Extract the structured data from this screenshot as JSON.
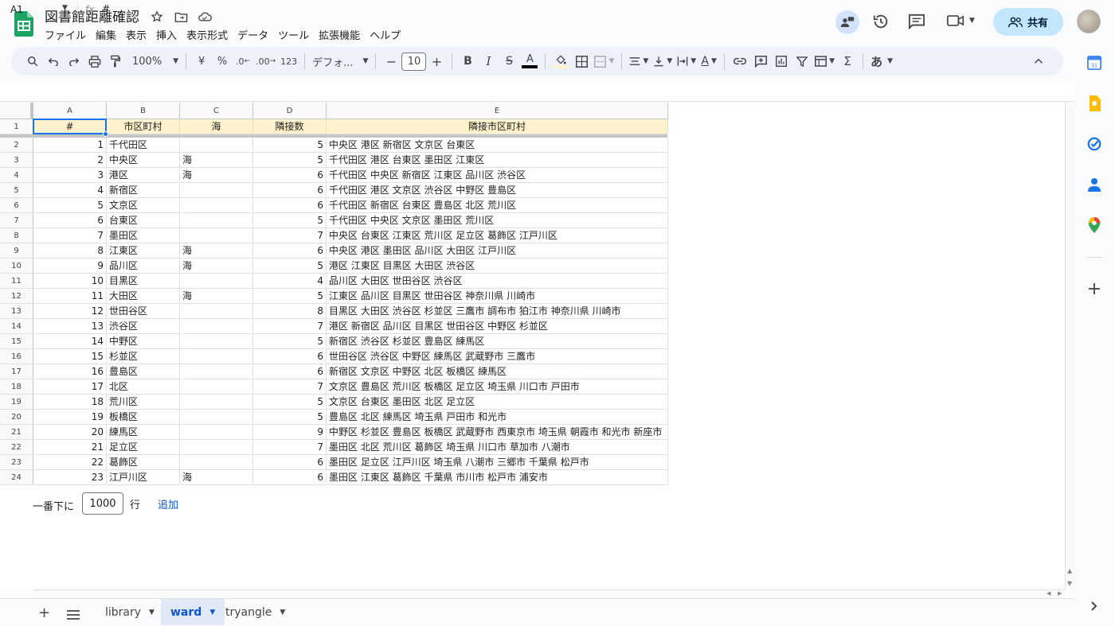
{
  "app": {
    "title": "図書館距離確認",
    "menu": [
      "ファイル",
      "編集",
      "表示",
      "挿入",
      "表示形式",
      "データ",
      "ツール",
      "拡張機能",
      "ヘルプ"
    ],
    "share_label": "共有"
  },
  "toolbar": {
    "zoom": "100%",
    "currency": "¥",
    "percent": "%",
    "dec_decrease": ".0",
    "dec_increase": ".00",
    "number_format": "123",
    "font_name": "デフォ...",
    "font_size": "10",
    "input_tool": "あ"
  },
  "formula": {
    "cell_ref": "A1",
    "fx": "fx",
    "content": "#"
  },
  "grid": {
    "columns": [
      "A",
      "B",
      "C",
      "D",
      "E"
    ],
    "header": [
      "#",
      "市区町村",
      "海",
      "隣接数",
      "隣接市区町村"
    ],
    "rows": [
      [
        "1",
        "千代田区",
        "",
        "5",
        "中央区 港区 新宿区 文京区 台東区"
      ],
      [
        "2",
        "中央区",
        "海",
        "5",
        "千代田区 港区 台東区 墨田区 江東区"
      ],
      [
        "3",
        "港区",
        "海",
        "6",
        "千代田区 中央区 新宿区 江東区 品川区 渋谷区"
      ],
      [
        "4",
        "新宿区",
        "",
        "6",
        "千代田区 港区 文京区 渋谷区 中野区 豊島区"
      ],
      [
        "5",
        "文京区",
        "",
        "6",
        "千代田区 新宿区 台東区 豊島区 北区 荒川区"
      ],
      [
        "6",
        "台東区",
        "",
        "5",
        "千代田区 中央区 文京区 墨田区 荒川区"
      ],
      [
        "7",
        "墨田区",
        "",
        "7",
        "中央区 台東区 江東区 荒川区 足立区 葛飾区 江戸川区"
      ],
      [
        "8",
        "江東区",
        "海",
        "6",
        "中央区 港区 墨田区 品川区 大田区 江戸川区"
      ],
      [
        "9",
        "品川区",
        "海",
        "5",
        "港区 江東区 目黒区 大田区 渋谷区"
      ],
      [
        "10",
        "目黒区",
        "",
        "4",
        "品川区 大田区 世田谷区 渋谷区"
      ],
      [
        "11",
        "大田区",
        "海",
        "5",
        "江東区 品川区 目黒区 世田谷区 神奈川県 川崎市"
      ],
      [
        "12",
        "世田谷区",
        "",
        "8",
        "目黒区 大田区 渋谷区 杉並区 三鷹市 調布市 狛江市 神奈川県 川崎市"
      ],
      [
        "13",
        "渋谷区",
        "",
        "7",
        "港区 新宿区 品川区 目黒区 世田谷区 中野区 杉並区"
      ],
      [
        "14",
        "中野区",
        "",
        "5",
        "新宿区 渋谷区 杉並区 豊島区 練馬区"
      ],
      [
        "15",
        "杉並区",
        "",
        "6",
        "世田谷区 渋谷区 中野区 練馬区 武蔵野市 三鷹市"
      ],
      [
        "16",
        "豊島区",
        "",
        "6",
        "新宿区 文京区 中野区 北区 板橋区 練馬区"
      ],
      [
        "17",
        "北区",
        "",
        "7",
        "文京区 豊島区 荒川区 板橋区 足立区 埼玉県 川口市 戸田市"
      ],
      [
        "18",
        "荒川区",
        "",
        "5",
        "文京区 台東区 墨田区 北区 足立区"
      ],
      [
        "19",
        "板橋区",
        "",
        "5",
        "豊島区 北区 練馬区 埼玉県 戸田市 和光市"
      ],
      [
        "20",
        "練馬区",
        "",
        "9",
        "中野区 杉並区 豊島区 板橋区 武蔵野市 西東京市 埼玉県 朝霞市 和光市 新座市"
      ],
      [
        "21",
        "足立区",
        "",
        "7",
        "墨田区 北区 荒川区 葛飾区 埼玉県 川口市 草加市 八潮市"
      ],
      [
        "22",
        "葛飾区",
        "",
        "6",
        "墨田区 足立区 江戸川区 埼玉県 八潮市 三郷市 千葉県 松戸市"
      ],
      [
        "23",
        "江戸川区",
        "海",
        "6",
        "墨田区 江東区 葛飾区 千葉県 市川市 松戸市 浦安市"
      ]
    ]
  },
  "add_rows": {
    "prefix": "一番下に",
    "count": "1000",
    "unit": "行",
    "button": "追加"
  },
  "sheets": [
    {
      "label": "library",
      "active": false
    },
    {
      "label": "ward",
      "active": true
    },
    {
      "label": "tryangle",
      "active": false
    }
  ],
  "colors": {
    "header_fill": "#fff2cc",
    "accent": "#1a73e8",
    "share_bg": "#c2e7ff"
  }
}
